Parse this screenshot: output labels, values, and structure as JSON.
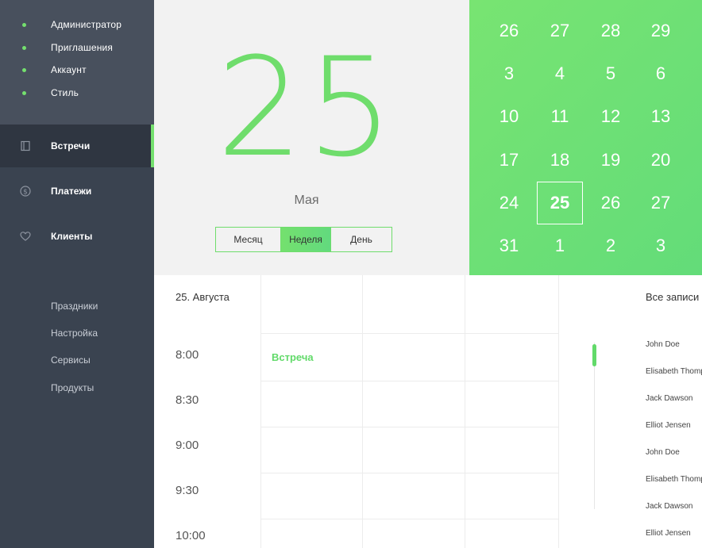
{
  "sidebar": {
    "top_items": [
      {
        "label": "Администратор"
      },
      {
        "label": "Приглашения"
      },
      {
        "label": "Аккаунт"
      },
      {
        "label": "Стиль"
      }
    ],
    "nav_items": [
      {
        "label": "Встречи",
        "icon": "book-icon"
      },
      {
        "label": "Платежи",
        "icon": "dollar-icon"
      },
      {
        "label": "Клиенты",
        "icon": "heart-icon"
      }
    ],
    "sub_items": [
      {
        "label": "Праздники"
      },
      {
        "label": "Настройка"
      },
      {
        "label": "Сервисы"
      },
      {
        "label": "Продукты"
      }
    ]
  },
  "date_header": {
    "day": "25",
    "month": "Мая",
    "views": [
      "Месяц",
      "Неделя",
      "День"
    ],
    "active_view": "Неделя"
  },
  "calendar": {
    "rows": [
      [
        "26",
        "27",
        "28",
        "29"
      ],
      [
        "3",
        "4",
        "5",
        "6"
      ],
      [
        "10",
        "11",
        "12",
        "13"
      ],
      [
        "17",
        "18",
        "19",
        "20"
      ],
      [
        "24",
        "25",
        "26",
        "27"
      ],
      [
        "31",
        "1",
        "2",
        "3"
      ]
    ],
    "partial_col": "4",
    "selected": "25"
  },
  "schedule": {
    "date": "25. Августа",
    "times": [
      "8:00",
      "8:30",
      "9:00",
      "9:30",
      "10:00"
    ],
    "event": "Встреча",
    "records_title": "Все записи",
    "records": [
      "John Doe",
      "Elisabeth Thompson",
      "Jack Dawson",
      "Elliot Jensen",
      "John Doe",
      "Elisabeth Thompson",
      "Jack Dawson",
      "Elliot Jensen"
    ]
  },
  "colors": {
    "accent": "#74e06e",
    "sidebar": "#3a4350",
    "sidebar_top": "#48505d",
    "sidebar_active": "#2f3641"
  }
}
